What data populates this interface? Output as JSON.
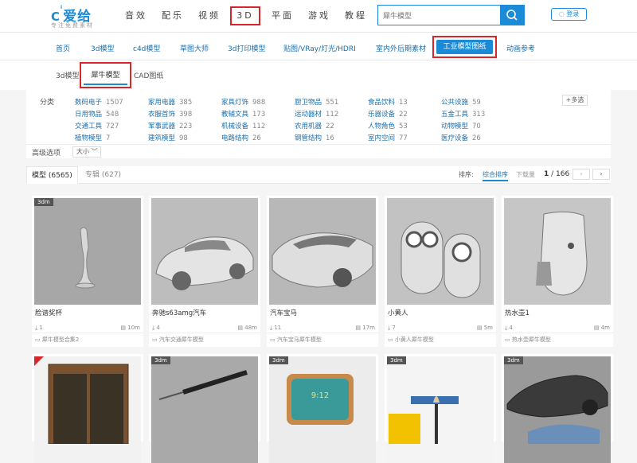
{
  "logo": {
    "name": "爱给",
    "subtitle": "专注免费素材"
  },
  "main_nav": [
    "音效",
    "配乐",
    "视频",
    "3D",
    "平面",
    "游戏",
    "教程"
  ],
  "search": {
    "value": "犀牛模型"
  },
  "login": "登录",
  "sub_nav": [
    "首页",
    "3d模型",
    "c4d模型",
    "草图大师",
    "3d打印模型",
    "贴图/VRay/灯光/HDRI",
    "室内外后期素材",
    "工业模型图纸",
    "动画参考"
  ],
  "type_tabs": [
    "3d模型",
    "犀牛模型",
    "CAD图纸"
  ],
  "categories": {
    "label": "分类",
    "more": "+多选",
    "items": [
      {
        "name": "数码电子",
        "count": "1507"
      },
      {
        "name": "家用电器",
        "count": "385"
      },
      {
        "name": "家具灯饰",
        "count": "988"
      },
      {
        "name": "厨卫物品",
        "count": "551"
      },
      {
        "name": "食品饮料",
        "count": "13"
      },
      {
        "name": "公共设施",
        "count": "59"
      },
      {
        "name": "日用物品",
        "count": "548"
      },
      {
        "name": "衣服首饰",
        "count": "398"
      },
      {
        "name": "教辅文具",
        "count": "173"
      },
      {
        "name": "运动器材",
        "count": "112"
      },
      {
        "name": "乐器设备",
        "count": "22"
      },
      {
        "name": "五金工具",
        "count": "313"
      },
      {
        "name": "交通工具",
        "count": "727"
      },
      {
        "name": "军事武器",
        "count": "223"
      },
      {
        "name": "机械设备",
        "count": "112"
      },
      {
        "name": "农用机器",
        "count": "22"
      },
      {
        "name": "人物角色",
        "count": "53"
      },
      {
        "name": "动物模型",
        "count": "70"
      },
      {
        "name": "植物模型",
        "count": "7"
      },
      {
        "name": "建筑模型",
        "count": "98"
      },
      {
        "name": "电路结构",
        "count": "26"
      },
      {
        "name": "钢管结构",
        "count": "16"
      },
      {
        "name": "室内空间",
        "count": "77"
      },
      {
        "name": "医疗设备",
        "count": "26"
      }
    ]
  },
  "advanced": {
    "label": "高级选项",
    "size_select": "大小"
  },
  "results": {
    "tab_models": "模型 (6565)",
    "tab_albums": "专辑 (627)",
    "sort_label": "排序:",
    "sort_options": [
      "综合排序",
      "下载量"
    ],
    "page": "1",
    "total_pages": "/ 166"
  },
  "cards_row1": [
    {
      "badge": "3dm",
      "title": "脸谱奖杯",
      "downloads": "1",
      "size": "10m",
      "tag": "犀牛模型合集2"
    },
    {
      "badge": "",
      "title": "奔驰s63amg汽车",
      "downloads": "4",
      "size": "48m",
      "tag": "汽车交通犀牛模型"
    },
    {
      "badge": "",
      "title": "汽车宝马",
      "downloads": "11",
      "size": "17m",
      "tag": "汽车宝马犀牛模型"
    },
    {
      "badge": "",
      "title": "小黄人",
      "downloads": "7",
      "size": "5m",
      "tag": "小黄人犀牛模型"
    },
    {
      "badge": "",
      "title": "热水壶1",
      "downloads": "4",
      "size": "4m",
      "tag": "热水壶犀牛模型"
    }
  ],
  "cards_row2": [
    {
      "badge": ""
    },
    {
      "badge": "3dm"
    },
    {
      "badge": "3dm"
    },
    {
      "badge": "3dm"
    },
    {
      "badge": "3dm"
    }
  ],
  "clock_text": "9:12"
}
